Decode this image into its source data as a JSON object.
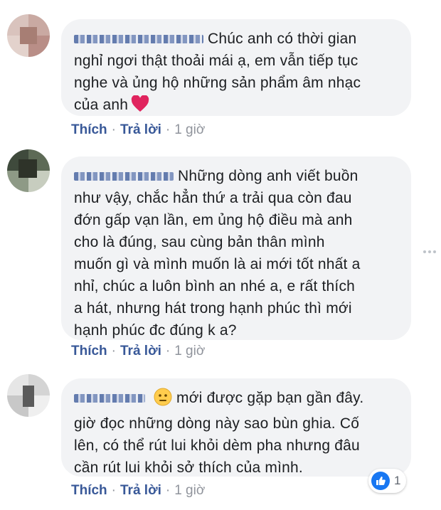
{
  "comments": [
    {
      "text_lines": [
        "Chúc anh có thời gian",
        "nghỉ ngơi thật thoải mái ạ, em vẫn tiếp tục",
        "nghe và ủng hộ những sản phẩm âm nhạc",
        "của anh"
      ],
      "actions": {
        "like": "Thích",
        "reply": "Trả lời",
        "time": "1 giờ"
      }
    },
    {
      "text_lines": [
        "Những dòng anh viết buồn",
        "như vậy, chắc hẳn thứ a trải qua còn đau",
        "đớn gấp vạn lần, em ủng hộ điều mà anh",
        "cho là đúng, sau cùng bản thân mình",
        "muốn gì và mình muốn là ai mới tốt nhất a",
        "nhỉ, chúc a luôn bình an nhé a, e rất thích",
        "a hát, nhưng hát trong hạnh phúc thì mới",
        "hạnh phúc đc đúng k a?"
      ],
      "actions": {
        "like": "Thích",
        "reply": "Trả lời",
        "time": "1 giờ"
      }
    },
    {
      "text_lines": [
        "mới được gặp bạn gần đây.",
        "giờ đọc những dòng này sao bùn ghia. Cố",
        "lên, có thể rút lui khỏi dèm pha nhưng đâu",
        "cần rút lui khỏi sở thích của mình."
      ],
      "actions": {
        "like": "Thích",
        "reply": "Trả lời",
        "time": "1 giờ"
      },
      "reaction_count": "1"
    }
  ],
  "icons": {
    "heart": "heart-icon",
    "emoji": "neutral-face-icon",
    "like": "like-icon",
    "more": "more-options-icon"
  },
  "colors": {
    "bubble": "#f2f3f5",
    "link": "#385898",
    "meta": "#90949c",
    "like": "#1877f2",
    "heart": "#e0245e"
  }
}
